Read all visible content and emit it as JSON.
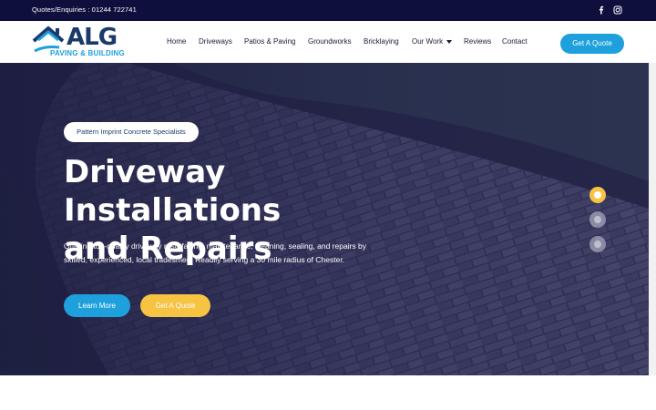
{
  "topbar": {
    "contact": "Quotes/Enquiries : 01244 722741",
    "social": [
      "facebook-icon",
      "instagram-icon"
    ]
  },
  "logo": {
    "word": "ALG",
    "tagline": "PAVING & BUILDING"
  },
  "nav": {
    "items": [
      "Home",
      "Driveways",
      "Patios & Paving",
      "Groundworks",
      "Bricklaying",
      "Our Work",
      "Reviews",
      "Contact"
    ],
    "cta": "Get A Quote"
  },
  "hero": {
    "pill": "Pattern Imprint Concrete Specialists",
    "title_line1": "Driveway Installations",
    "title_line2": "and Repairs",
    "text": "Offering top-quality driveway resurfacing, maintenance, cleaning, sealing, and repairs by skilled, experienced, local tradesmen. Readily serving a 30 mile radius of Chester.",
    "learn_more": "Learn More",
    "get_quote": "Get A Quote",
    "slides": 3,
    "active_slide": 1
  },
  "colors": {
    "navy": "#0f0f3d",
    "brand_blue": "#1ea0dc",
    "accent_yellow": "#f6c343",
    "logo_navy": "#1b3a6b"
  }
}
